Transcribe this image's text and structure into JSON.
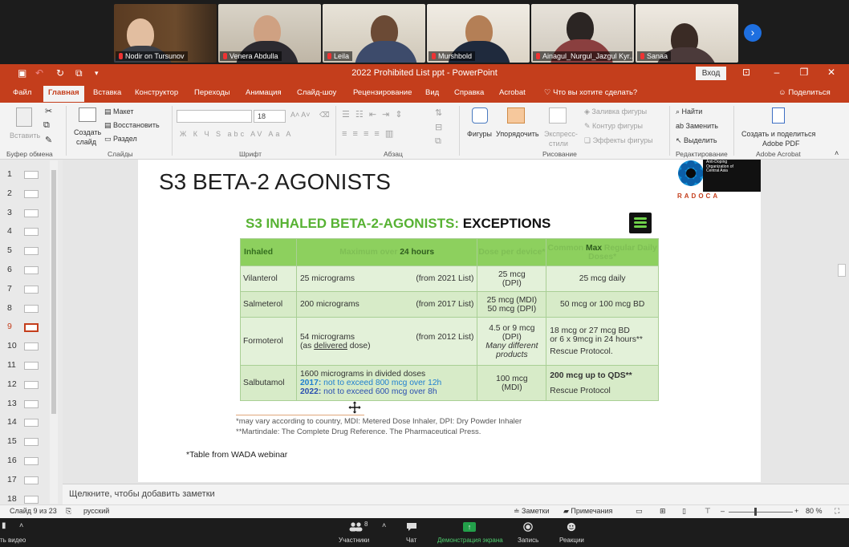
{
  "participants": [
    {
      "name": "Nodir on Tursunov"
    },
    {
      "name": "Venera Abdulla"
    },
    {
      "name": "Leila"
    },
    {
      "name": "Murshbold"
    },
    {
      "name": "Ainagul_Nurgul_Jazgul Kyr..."
    },
    {
      "name": "Sanaa"
    }
  ],
  "window": {
    "title": "2022 Prohibited List ppt  -  PowerPoint",
    "login_button": "Вход"
  },
  "tabs": [
    "Файл",
    "Главная",
    "Вставка",
    "Конструктор",
    "Переходы",
    "Анимация",
    "Слайд-шоу",
    "Рецензирование",
    "Вид",
    "Справка",
    "Acrobat"
  ],
  "tell_me": "Что вы хотите сделать?",
  "share": "Поделиться",
  "ribbon": {
    "clipboard": {
      "paste": "Вставить",
      "label": "Буфер обмена"
    },
    "slides": {
      "new_slide": "Создать",
      "new_slide_2": "слайд",
      "layout": "Макет",
      "reset": "Восстановить",
      "section": "Раздел",
      "label": "Слайды"
    },
    "font": {
      "size": "18",
      "label": "Шрифт"
    },
    "paragraph": {
      "label": "Абзац"
    },
    "drawing": {
      "shapes": "Фигуры",
      "arrange": "Упорядочить",
      "quick_styles": "Экспресс-",
      "quick_styles_2": "стили",
      "fill": "Заливка фигуры",
      "outline": "Контур фигуры",
      "effects": "Эффекты фигуры",
      "label": "Рисование"
    },
    "editing": {
      "find": "Найти",
      "replace": "Заменить",
      "select": "Выделить",
      "label": "Редактирование"
    },
    "acrobat": {
      "create_share": "Создать и поделиться",
      "create_share_2": "Adobe PDF",
      "label": "Adobe Acrobat"
    }
  },
  "thumbnails": [
    "1",
    "2",
    "3",
    "4",
    "5",
    "6",
    "7",
    "8",
    "9",
    "10",
    "11",
    "12",
    "13",
    "14",
    "15",
    "16",
    "17",
    "18"
  ],
  "selected_slide": "9",
  "slide": {
    "title": "S3 BETA-2 AGONISTS",
    "logo_org": "Anti-Doping Organization of Central Asia",
    "logo_word": "RADOCA",
    "subtitle_green": "S3 INHALED BETA-2-AGONISTS: ",
    "subtitle_black": "EXCEPTIONS",
    "table": {
      "headers": {
        "c0": "Inhaled",
        "c1_a": "Maximum over ",
        "c1_b": "24 hours",
        "c2": "Dose per device*",
        "c3_a": "Common ",
        "c3_b": "Max",
        "c3_c": " Regular Daily Doses*"
      },
      "rows": [
        {
          "name": "Vilanterol",
          "max": "25 micrograms",
          "from": "(from 2021 List)",
          "dose_a": "25 mcg",
          "dose_b": "(DPI)",
          "common": "25 mcg daily"
        },
        {
          "name": "Salmeterol",
          "max": "200 micrograms",
          "from": "(from  2017 List)",
          "dose_a": "25 mcg (MDI)",
          "dose_b": "50 mcg (DPI)",
          "common": "50 mcg or 100 mcg BD"
        },
        {
          "name": "Formoterol",
          "max": "54 micrograms",
          "max_b1": "(as ",
          "max_b2": "delivered",
          "max_b3": " dose)",
          "from": "(from 2012 List)",
          "dose_a": "4.5 or 9 mcg",
          "dose_b": "(DPI)",
          "dose_c": "Many different",
          "dose_d": "products",
          "common_a": "18 mcg or 27 mcg BD",
          "common_b": "or 6 x 9mcg in 24 hours**",
          "common_c": "Rescue Protocol."
        },
        {
          "name": "Salbutamol",
          "max_a": "1600 micrograms in divided doses",
          "y17": "2017:",
          "y17_text": " not to exceed 800 mcg over 12h",
          "y22": "2022:",
          "y22_text": " not to exceed 600 mcg over 8h",
          "dose_a": "100 mcg",
          "dose_b": "(MDI)",
          "common_a": "200 mcg  up to QDS**",
          "common_b": "Rescue Protocol"
        }
      ]
    },
    "footnote_1": "*may vary according to country, MDI: Metered Dose Inhaler, DPI: Dry Powder Inhaler",
    "footnote_2": "**Martindale: The Complete Drug Reference. The Pharmaceutical Press.",
    "source": "*Table from WADA webinar"
  },
  "notes_placeholder": "Щелкните, чтобы добавить заметки",
  "status": {
    "slide": "Слайд 9 из 23",
    "language": "русский",
    "notes": "Заметки",
    "comments": "Примечания",
    "zoom": "80 %"
  },
  "zoom_toolbar": {
    "video": "ть видео",
    "participants": "Участники",
    "participant_count": "8",
    "chat": "Чат",
    "share": "Демонстрация экрана",
    "record": "Запись",
    "reactions": "Реакции"
  },
  "colors": {
    "ppt_accent": "#c43e1c",
    "table_header": "#8dd05e",
    "subtitle_green": "#57b233",
    "zoom_share_green": "#23a04a"
  }
}
